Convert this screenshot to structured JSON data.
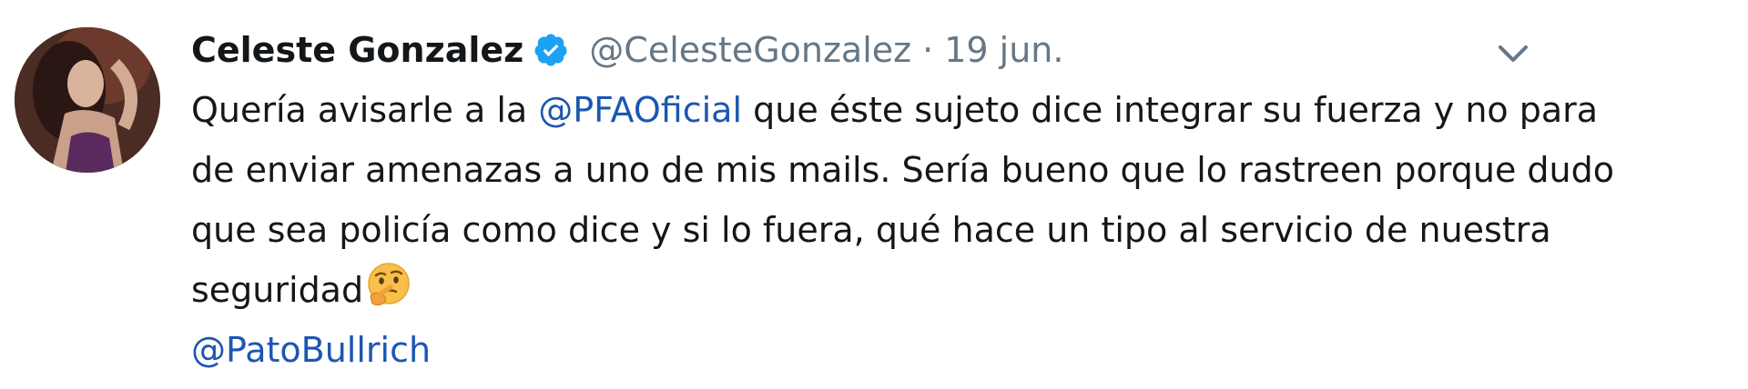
{
  "tweet": {
    "author_name": "Celeste Gonzalez",
    "handle": "@CelesteGonzalez",
    "separator": "·",
    "date": "19 jun.",
    "text": {
      "line1_prefix": "Quería avisarle a la ",
      "mention1": "@PFAOficial",
      "line1_suffix": " que éste sujeto dice integrar su fuerza y no para",
      "line2": "de enviar amenazas a uno de mis mails. Sería bueno que lo rastreen porque dudo",
      "line3": "que sea policía como dice y si lo fuera, qué hace un tipo al servicio de nuestra",
      "line4": "seguridad",
      "mention2": "@PatoBullrich"
    },
    "icons": {
      "verified": "verified-badge-icon",
      "emoji": "thinking-face-emoji",
      "menu": "chevron-down-icon"
    },
    "colors": {
      "name": "#14171a",
      "secondary": "#657786",
      "link": "#1b57b1",
      "verified": "#1da1f2"
    }
  }
}
